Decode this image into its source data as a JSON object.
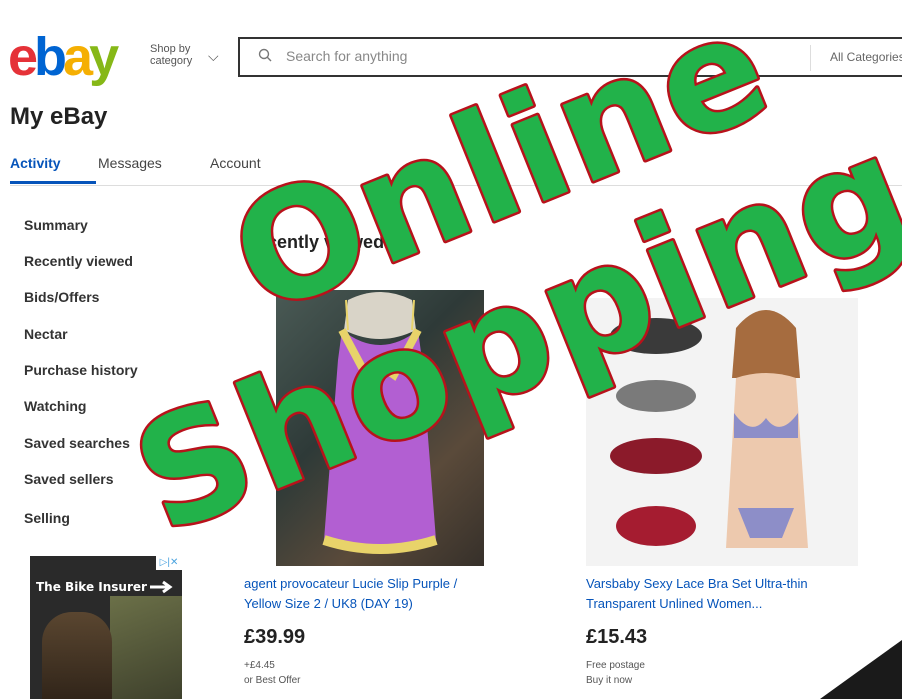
{
  "header": {
    "logo_letters": [
      "e",
      "b",
      "a",
      "y"
    ],
    "logo_colors": [
      "#e53238",
      "#0064d2",
      "#f5af02",
      "#86b817"
    ],
    "shop_by_line1": "Shop by",
    "shop_by_line2": "category",
    "search_placeholder": "Search for anything",
    "all_categories": "All Categories"
  },
  "page": {
    "title": "My eBay"
  },
  "tabs": [
    {
      "label": "Activity",
      "active": true
    },
    {
      "label": "Messages",
      "active": false
    },
    {
      "label": "Account",
      "active": false
    }
  ],
  "sidebar": {
    "items": [
      {
        "label": "Summary"
      },
      {
        "label": "Recently viewed"
      },
      {
        "label": "Bids/Offers"
      },
      {
        "label": "Nectar"
      },
      {
        "label": "Purchase history"
      },
      {
        "label": "Watching"
      },
      {
        "label": "Saved searches"
      },
      {
        "label": "Saved sellers"
      },
      {
        "label": "Selling"
      }
    ]
  },
  "ad": {
    "headline": "The Bike Insurer",
    "close_label": "▷|✕"
  },
  "main": {
    "section_title": "Recently viewed",
    "items": [
      {
        "title_line1": "agent provocateur Lucie Slip Purple /",
        "title_line2": "Yellow Size 2 / UK8 (DAY 19)",
        "price": "£39.99",
        "meta_line1": "+£4.45",
        "meta_line2": "or Best Offer"
      },
      {
        "title_line1": "Varsbaby Sexy Lace Bra Set Ultra-thin",
        "title_line2": "Transparent Unlined Women...",
        "price": "£15.43",
        "meta_line1": "Free postage",
        "meta_line2": "Buy it now"
      }
    ]
  },
  "overlay": {
    "word1": "Online",
    "word2": "Shopping",
    "fill_color": "#22b24a",
    "stroke_color": "#b8121b"
  },
  "colors": {
    "link": "#0654ba",
    "tab_active": "#0654ba"
  }
}
